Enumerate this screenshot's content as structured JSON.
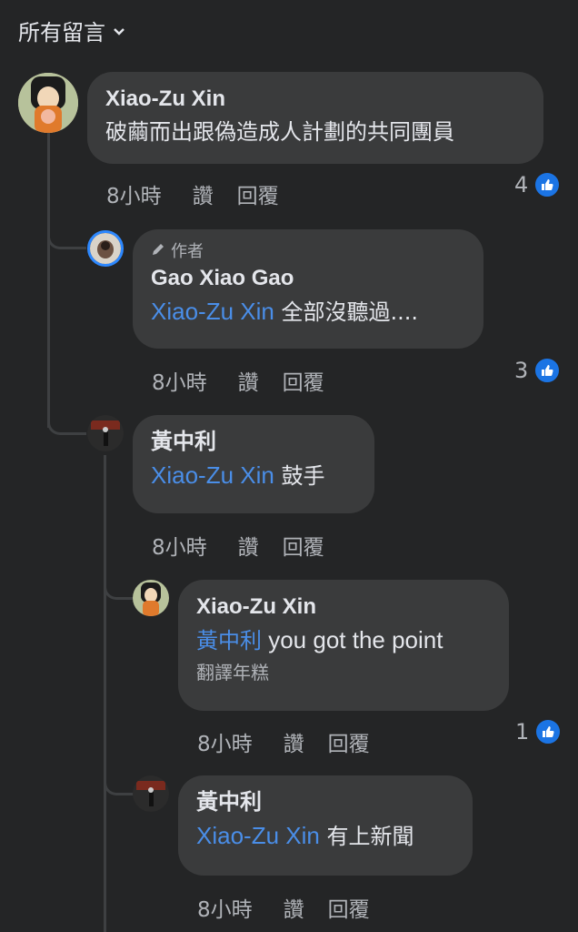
{
  "header": {
    "label": "所有留言",
    "chevron_icon": "chevron-down-icon"
  },
  "comments": [
    {
      "author": "Xiao-Zu Xin",
      "text": "破繭而出跟偽造成人計劃的共同團員",
      "time": "8小時",
      "like": "讚",
      "reply": "回覆",
      "reactions": "4"
    },
    {
      "author_tag": "作者",
      "author": "Gao Xiao Gao",
      "mention": "Xiao-Zu Xin",
      "text": " 全部沒聽過....",
      "time": "8小時",
      "like": "讚",
      "reply": "回覆",
      "reactions": "3"
    },
    {
      "author": "黃中利",
      "mention": "Xiao-Zu Xin",
      "text": " 鼓手",
      "time": "8小時",
      "like": "讚",
      "reply": "回覆"
    },
    {
      "author": "Xiao-Zu Xin",
      "mention": "黃中利",
      "text": " you got the point",
      "translate": "翻譯年糕",
      "time": "8小時",
      "like": "讚",
      "reply": "回覆",
      "reactions": "1"
    },
    {
      "author": "黃中利",
      "mention": "Xiao-Zu Xin",
      "text": " 有上新聞",
      "time": "8小時",
      "like": "讚",
      "reply": "回覆"
    }
  ],
  "colors": {
    "background": "#242526",
    "bubble": "#3a3b3c",
    "mention": "#4a8ee8",
    "like": "#1b74e4"
  }
}
